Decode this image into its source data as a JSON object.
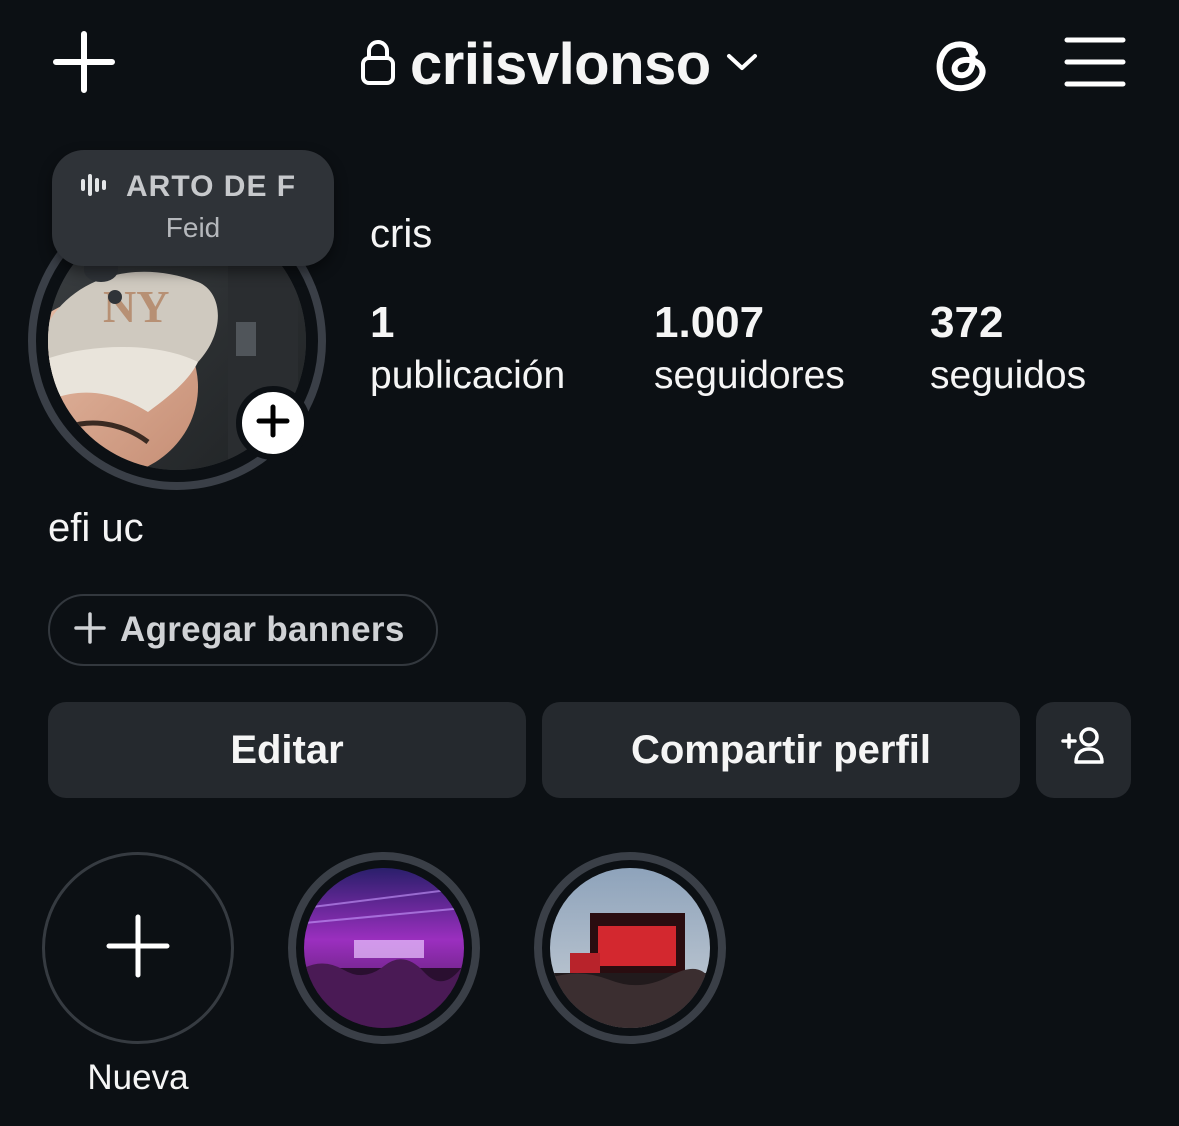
{
  "header": {
    "username": "criisvlonso"
  },
  "note": {
    "title": "ARTO DE F",
    "artist": "Feid"
  },
  "profile": {
    "display_name": "cris",
    "bio": "efi uc",
    "stats": [
      {
        "value": "1",
        "label": "publicación"
      },
      {
        "value": "1.007",
        "label": "seguidores"
      },
      {
        "value": "372",
        "label": "seguidos"
      }
    ]
  },
  "actions": {
    "banners_label": "Agregar banners",
    "edit_label": "Editar",
    "share_label": "Compartir perfil"
  },
  "highlights": {
    "new_label": "Nueva"
  },
  "icons": {
    "create": "plus-icon",
    "private": "lock-icon",
    "account_switch": "chevron-down-icon",
    "threads": "threads-icon",
    "menu": "hamburger-menu-icon",
    "avatar_add": "plus-circle-icon",
    "music": "sound-bars-icon",
    "discover_people": "add-person-icon"
  },
  "colors": {
    "background": "#0c1014",
    "button": "#25292e",
    "ring": "#3a3f47"
  }
}
